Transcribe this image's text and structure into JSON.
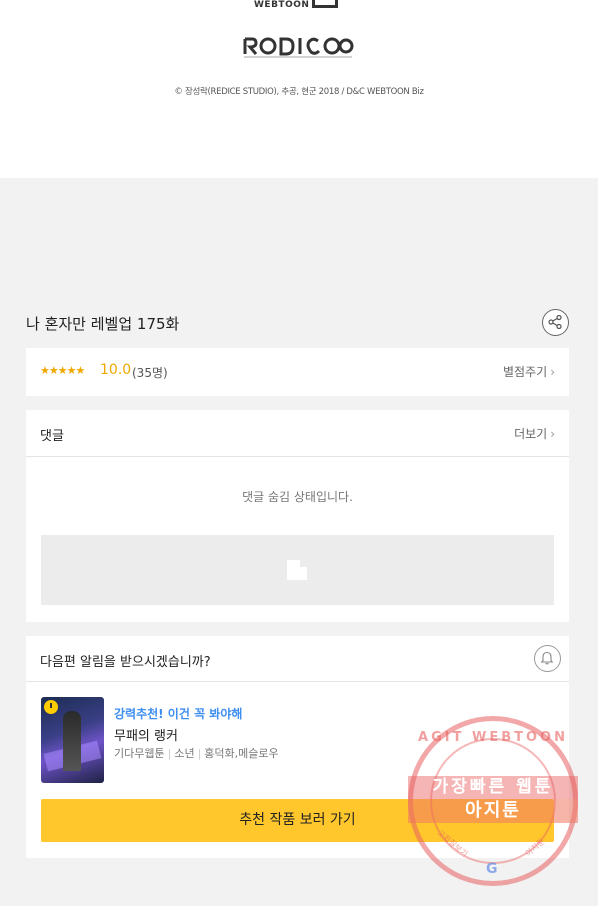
{
  "footer": {
    "webtoon_logo_text": "WEBTOON",
    "studio_logo_text": "REDICE",
    "copyright": "© 장성락(REDICE STUDIO), 추공, 현군 2018 / D&C WEBTOON Biz"
  },
  "episode": {
    "title": "나 혼자만 레벨업 175화",
    "share_icon": "share-icon"
  },
  "rating": {
    "stars": "★★★★★",
    "score": "10.0",
    "count": "(35명)",
    "rate_link": "별점주기",
    "chevron": "›"
  },
  "comments": {
    "label": "댓글",
    "more_link": "더보기",
    "chevron": "›",
    "hidden_message": "댓글 숨김 상태입니다."
  },
  "next_episode": {
    "question": "다음편 알림을 받으시겠습니까?",
    "bell_icon": "bell-icon"
  },
  "recommendation": {
    "tag": "강력추천! 이건 꼭 봐야해",
    "title": "무패의 랭커",
    "meta": [
      "기다무웹툰",
      "소년",
      "홍덕화,메슬로우"
    ],
    "sep": "|",
    "button_label": "추천 작품 보러 가기"
  },
  "watermark": {
    "top_text": "AGIT WEBTOON",
    "band_text": "가장빠른 웹툰",
    "band2_text": "아지툰",
    "bottom_left": "고화질보기",
    "bottom_right": "아지툰",
    "g_letter": "G"
  },
  "colors": {
    "accent_yellow": "#ffc72c",
    "star_orange": "#f0a800",
    "link_blue": "#3d8ef0",
    "watermark_red": "#e86060"
  }
}
